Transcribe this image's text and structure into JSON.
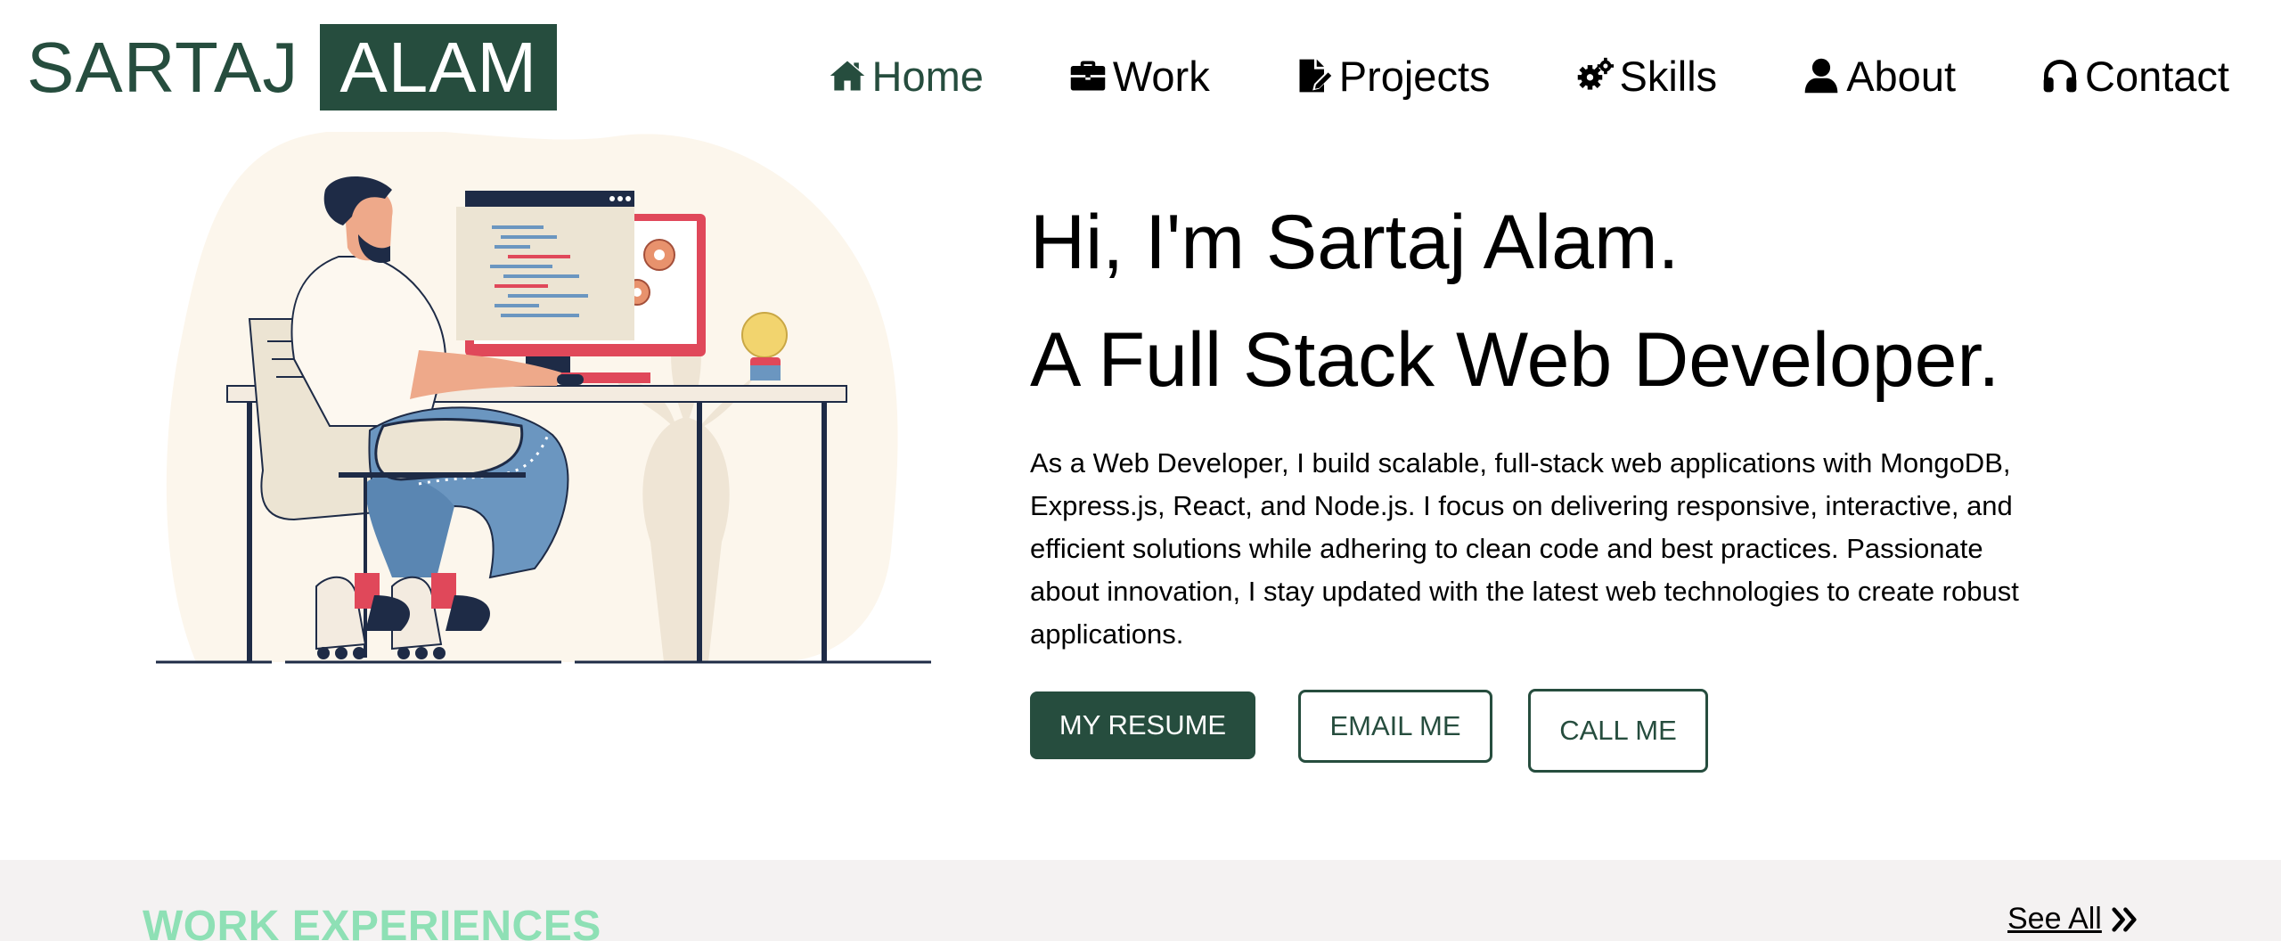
{
  "logo": {
    "first": "SARTAJ",
    "last": "ALAM"
  },
  "nav": {
    "items": [
      {
        "label": "Home",
        "icon": "home-icon",
        "active": true
      },
      {
        "label": "Work",
        "icon": "briefcase-icon"
      },
      {
        "label": "Projects",
        "icon": "file-signature-icon"
      },
      {
        "label": "Skills",
        "icon": "gears-icon"
      },
      {
        "label": "About",
        "icon": "user-icon"
      },
      {
        "label": "Contact",
        "icon": "headphones-icon"
      }
    ]
  },
  "hero": {
    "title": "Hi, I'm Sartaj Alam.",
    "subtitle": "A Full Stack Web Developer.",
    "description": "As a Web Developer, I build scalable, full-stack web applications with MongoDB, Express.js, React, and Node.js. I focus on delivering responsive, interactive, and efficient solutions while adhering to clean code and best practices. Passionate about innovation, I stay updated with the latest web technologies to create robust applications.",
    "buttons": {
      "resume": "MY RESUME",
      "email": "EMAIL ME",
      "call": "CALL ME"
    }
  },
  "work": {
    "title": "WORK EXPERIENCES",
    "see_all": "See All"
  },
  "colors": {
    "primary": "#264d3e",
    "accent_green": "#8ee0b5",
    "section_bg": "#f4f2f2",
    "blob": "#fcf6ec",
    "red": "#e0485a",
    "navy": "#1e2b46",
    "jeans": "#6b96c0"
  }
}
